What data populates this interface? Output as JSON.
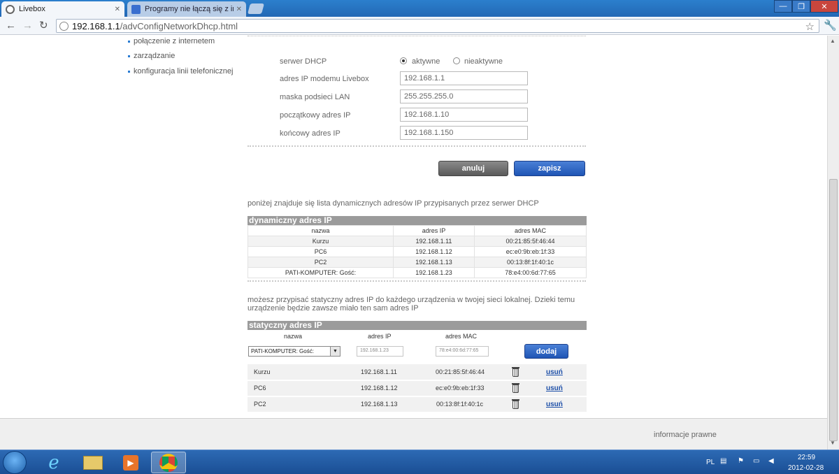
{
  "browser": {
    "tabs": [
      {
        "title": "Livebox",
        "close": "✕"
      },
      {
        "title": "Programy nie łączą się z inte",
        "close": "✕"
      }
    ],
    "window_controls": {
      "minimize": "—",
      "maximize": "❐",
      "close": "✕"
    },
    "url_host": "192.168.1.1",
    "url_path": "/advConfigNetworkDhcp.html"
  },
  "sidebar": {
    "items": [
      {
        "label": "połączenie z internetem"
      },
      {
        "label": "zarządzanie"
      },
      {
        "label": "konfiguracja linii telefonicznej"
      }
    ]
  },
  "dhcp_form": {
    "server_label": "serwer DHCP",
    "radio_active": "aktywne",
    "radio_inactive": "nieaktywne",
    "selected": "aktywne",
    "fields": [
      {
        "label": "adres IP modemu Livebox",
        "value": "192.168.1.1"
      },
      {
        "label": "maska podsieci LAN",
        "value": "255.255.255.0"
      },
      {
        "label": "początkowy adres IP",
        "value": "192.168.1.10"
      },
      {
        "label": "końcowy adres IP",
        "value": "192.168.1.150"
      }
    ],
    "cancel_label": "anuluj",
    "save_label": "zapisz"
  },
  "dynamic_info": "poniżej znajduje się lista dynamicznych adresów IP przypisanych przez serwer DHCP",
  "dynamic_table": {
    "title": "dynamiczny adres IP",
    "headers": [
      "nazwa",
      "adres IP",
      "adres MAC"
    ],
    "rows": [
      [
        "Kurzu",
        "192.168.1.11",
        "00:21:85:5f:46:44"
      ],
      [
        "PC6",
        "192.168.1.12",
        "ec:e0:9b:eb:1f:33"
      ],
      [
        "PC2",
        "192.168.1.13",
        "00:13:8f:1f:40:1c"
      ],
      [
        "PATI-KOMPUTER: Gość:",
        "192.168.1.23",
        "78:e4:00:6d:77:65"
      ]
    ]
  },
  "static_info_line1": "możesz przypisać statyczny adres IP do każdego urządzenia w twojej sieci lokalnej. Dzieki temu",
  "static_info_line2": "urządzenie będzie zawsze miało ten sam adres IP",
  "static_table": {
    "title": "statyczny adres IP",
    "headers": [
      "nazwa",
      "adres IP",
      "adres MAC"
    ],
    "device_select": "PATI-KOMPUTER: Gość:",
    "ip_input": "192.168.1.23",
    "mac_input": "78:e4:00:6d:77:65",
    "add_label": "dodaj",
    "remove_label": "usuń",
    "rows": [
      [
        "Kurzu",
        "192.168.1.11",
        "00:21:85:5f:46:44"
      ],
      [
        "PC6",
        "192.168.1.12",
        "ec:e0:9b:eb:1f:33"
      ],
      [
        "PC2",
        "192.168.1.13",
        "00:13:8f:1f:40:1c"
      ]
    ]
  },
  "footer": {
    "legal": "informacje prawne"
  },
  "taskbar": {
    "lang": "PL",
    "time": "22:59",
    "date": "2012-02-28"
  },
  "colors": {
    "accent_blue": "#2459b8",
    "header_gray": "#9b9b9b",
    "taskbar": "#1f5aa2"
  }
}
